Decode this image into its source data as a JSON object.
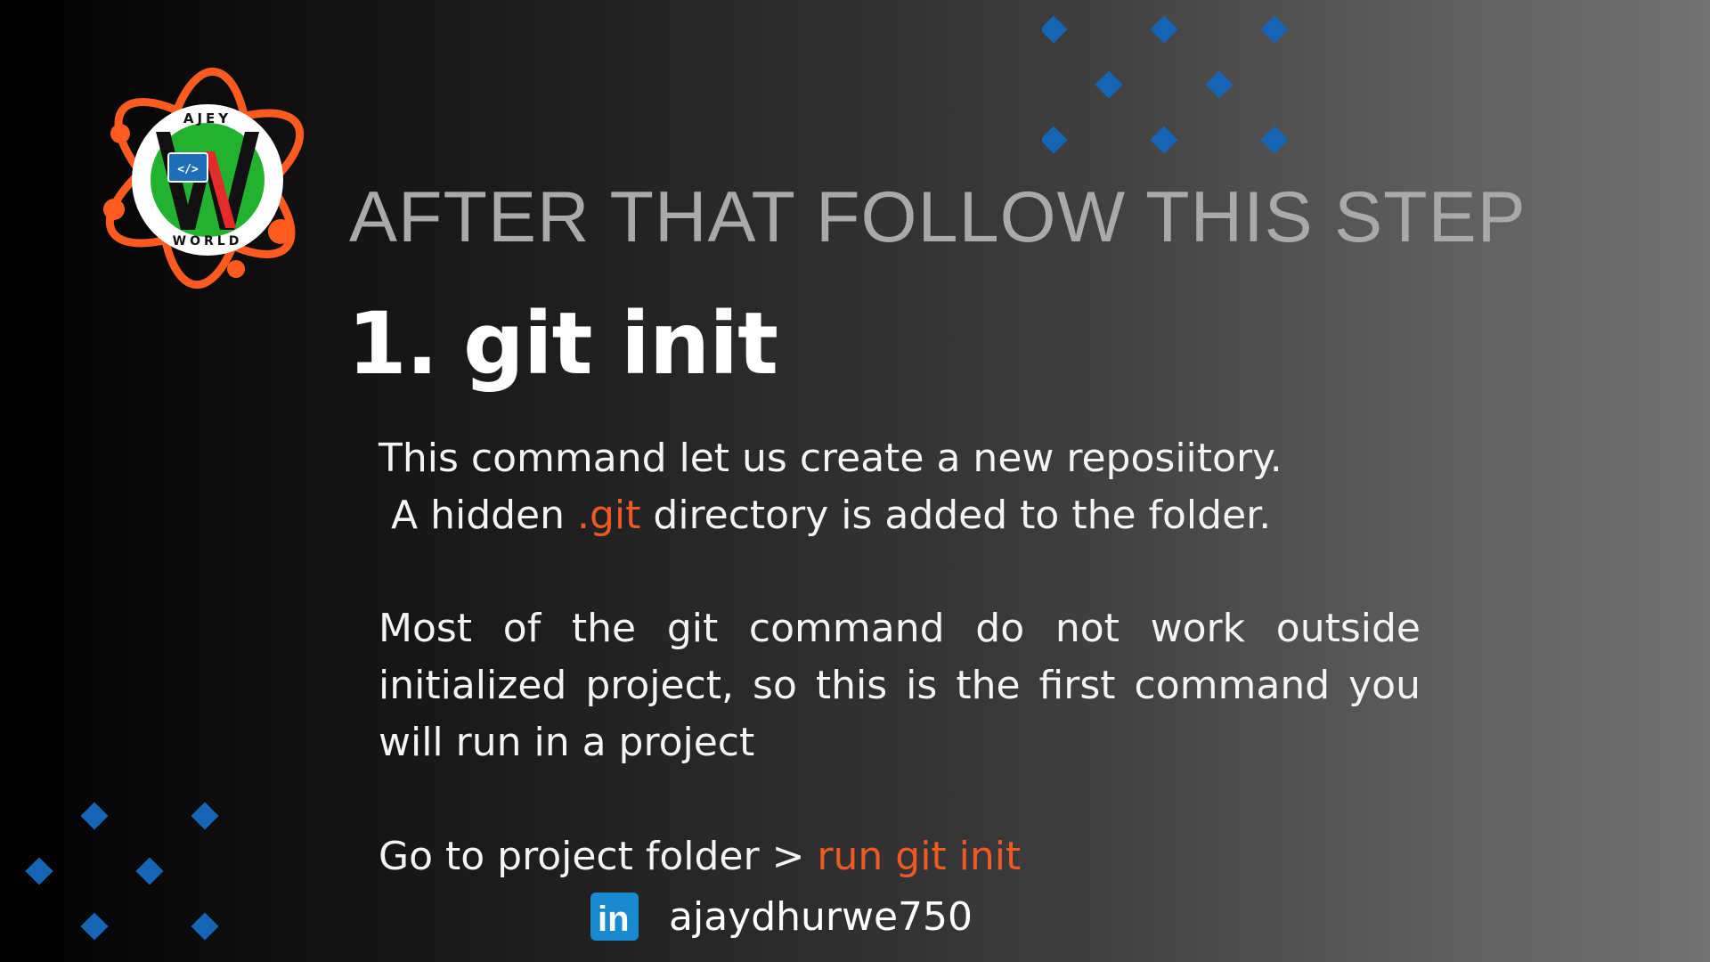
{
  "logo": {
    "top_text": "AJEY",
    "bottom_text": "WORLD",
    "code_glyph": "</>",
    "icon": "ajey-world-logo"
  },
  "heading": "AFTER THAT FOLLOW THIS STEP",
  "step": {
    "number": "1.",
    "command": "git init"
  },
  "paragraph1": {
    "line1": "This command let us create a new reposiitory.",
    "line2_before": "A hidden ",
    "line2_highlight": ".git",
    "line2_after": " directory is added to the folder."
  },
  "paragraph2": "Most of the git command do not work outside initialized project, so this is the first command you will run in a project",
  "paragraph3": {
    "before": "Go to project folder > ",
    "highlight": "run git init"
  },
  "footer": {
    "icon": "linkedin-icon",
    "icon_text": "in",
    "handle": "ajaydhurwe750"
  },
  "colors": {
    "accent": "#ef5a24",
    "diamond": "#1565b4",
    "heading": "#a9a9a9",
    "logo_green": "#22b230",
    "logo_red": "#e32b2b",
    "linkedin": "#1a8ad0"
  }
}
